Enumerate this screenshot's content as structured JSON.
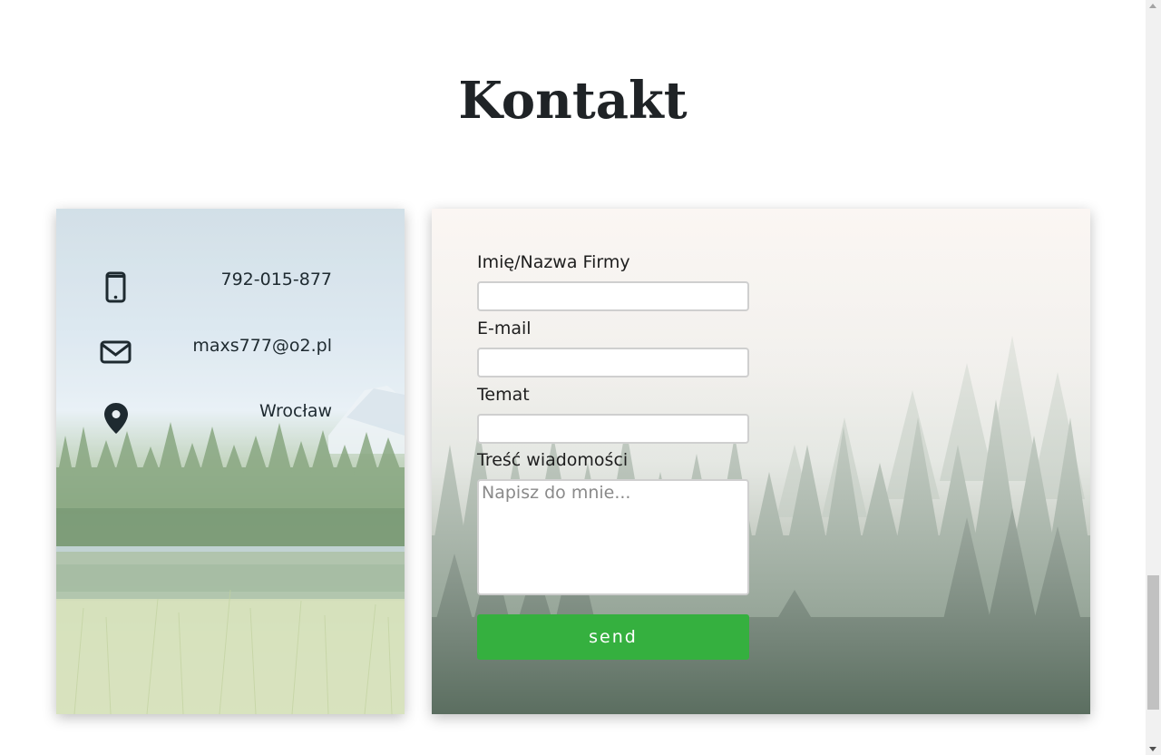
{
  "page": {
    "title": "Kontakt"
  },
  "contact_info": {
    "phone": {
      "icon": "mobile-phone-icon",
      "text": "792-015-877"
    },
    "email": {
      "icon": "envelope-icon",
      "text": "maxs777@o2.pl"
    },
    "location": {
      "icon": "map-marker-icon",
      "text": "Wrocław"
    }
  },
  "form": {
    "name_label": "Imię/Nazwa Firmy",
    "name_value": "",
    "email_label": "E-mail",
    "email_value": "",
    "subject_label": "Temat",
    "subject_value": "",
    "message_label": "Treść wiadomości",
    "message_placeholder": "Napisz do mnie...",
    "send_label": "send"
  },
  "colors": {
    "send_button": "#35b03f",
    "title_text": "#1f2326"
  }
}
